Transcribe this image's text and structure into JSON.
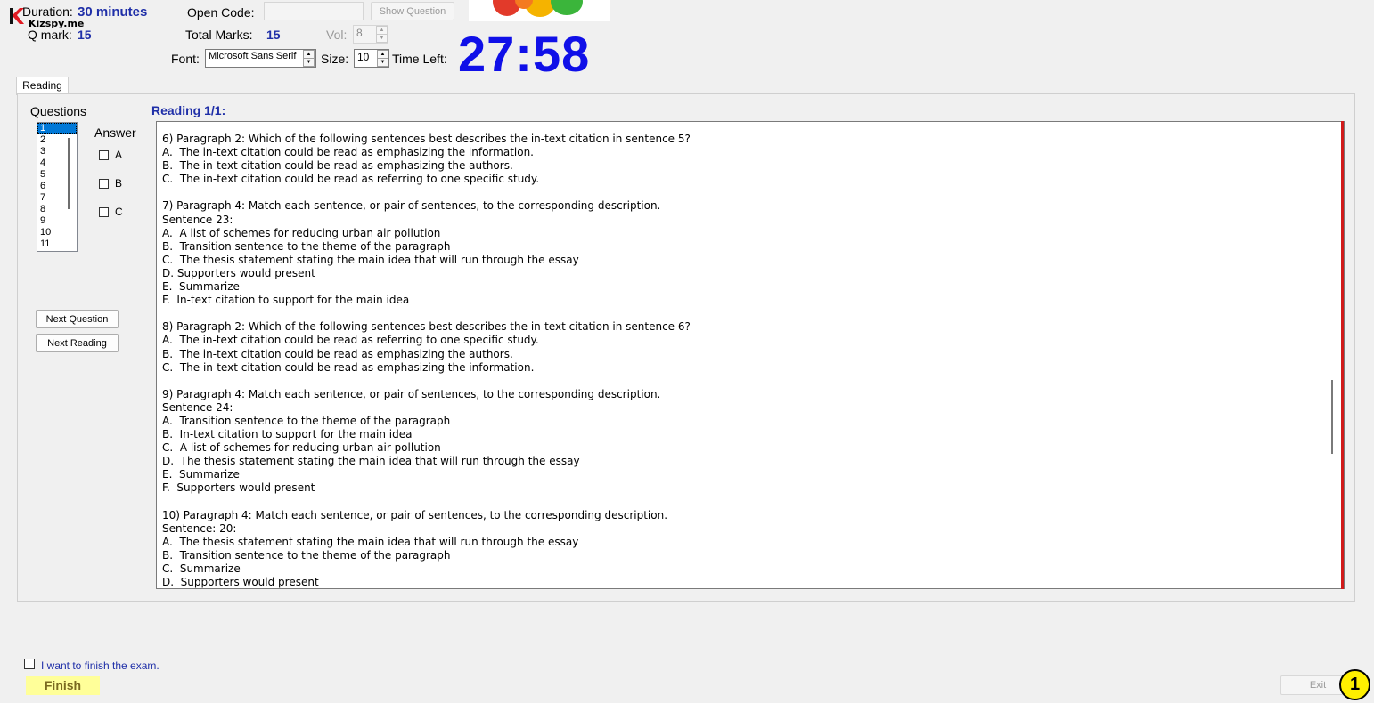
{
  "brand": {
    "logo_letter": "K",
    "logo_text": "Kizspy.me"
  },
  "header": {
    "duration_label": "Duration:",
    "duration_value": "30 minutes",
    "qmark_label": "Q mark:",
    "qmark_value": "15",
    "open_code_label": "Open Code:",
    "open_code_value": "",
    "show_question_label": "Show Question",
    "total_marks_label": "Total Marks:",
    "total_marks_value": "15",
    "vol_label": "Vol:",
    "vol_value": "8",
    "font_label": "Font:",
    "font_value": "Microsoft Sans Serif",
    "size_label": "Size:",
    "size_value": "10",
    "time_left_label": "Time Left:",
    "timer": "27:58"
  },
  "tabs": [
    {
      "label": "Reading"
    }
  ],
  "questions": {
    "heading": "Questions",
    "items": [
      "1",
      "2",
      "3",
      "4",
      "5",
      "6",
      "7",
      "8",
      "9",
      "10",
      "11"
    ],
    "selected": "1"
  },
  "answer": {
    "heading": "Answer",
    "options": [
      "A",
      "B",
      "C"
    ]
  },
  "buttons": {
    "next_question": "Next Question",
    "next_reading": "Next Reading",
    "finish": "Finish",
    "exit": "Exit"
  },
  "reading": {
    "title": "Reading 1/1:",
    "lines": [
      "6) Paragraph 2: Which of the following sentences best describes the in-text citation in sentence 5?",
      "A.  The in-text citation could be read as emphasizing the information.",
      "B.  The in-text citation could be read as emphasizing the authors.",
      "C.  The in-text citation could be read as referring to one specific study.",
      "",
      "7) Paragraph 4: Match each sentence, or pair of sentences, to the corresponding description.",
      "Sentence 23:",
      "A.  A list of schemes for reducing urban air pollution",
      "B.  Transition sentence to the theme of the paragraph",
      "C.  The thesis statement stating the main idea that will run through the essay",
      "D. Supporters would present",
      "E.  Summarize",
      "F.  In-text citation to support for the main idea",
      "",
      "8) Paragraph 2: Which of the following sentences best describes the in-text citation in sentence 6?",
      "A.  The in-text citation could be read as referring to one specific study.",
      "B.  The in-text citation could be read as emphasizing the authors.",
      "C.  The in-text citation could be read as emphasizing the information.",
      "",
      "9) Paragraph 4: Match each sentence, or pair of sentences, to the corresponding description.",
      "Sentence 24:",
      "A.  Transition sentence to the theme of the paragraph",
      "B.  In-text citation to support for the main idea",
      "C.  A list of schemes for reducing urban air pollution",
      "D.  The thesis statement stating the main idea that will run through the essay",
      "E.  Summarize",
      "F.  Supporters would present",
      "",
      "10) Paragraph 4: Match each sentence, or pair of sentences, to the corresponding description.",
      "Sentence: 20:",
      "A.  The thesis statement stating the main idea that will run through the essay",
      "B.  Transition sentence to the theme of the paragraph",
      "C.  Summarize",
      "D.  Supporters would present"
    ]
  },
  "finish_checkbox": {
    "label": "I want to finish the exam.",
    "checked": false
  },
  "badge": {
    "value": "1"
  },
  "colors": {
    "accent_blue": "#1f2fa8",
    "timer_blue": "#1010e8",
    "finish_bg": "#ffff99",
    "badge_yellow": "#ffef00",
    "red_bar": "#d11a1a"
  }
}
